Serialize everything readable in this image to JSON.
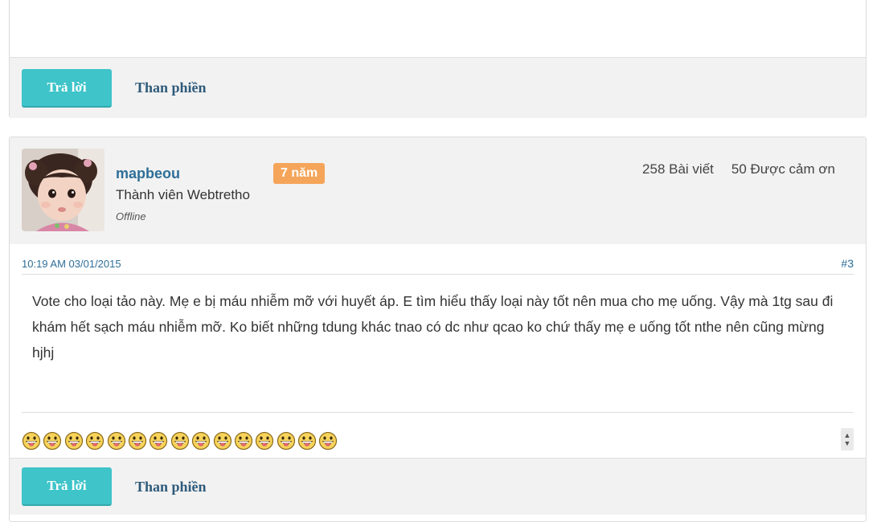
{
  "previous_post": {
    "reply_label": "Trả lời",
    "complain_label": "Than phiền"
  },
  "post": {
    "username": "mapbeou",
    "years_badge": "7 năm",
    "member_title": "Thành viên Webtretho",
    "status": "Offline",
    "stats": {
      "posts": "258 Bài viết",
      "thanks": "50 Được cảm ơn"
    },
    "timestamp": "10:19 AM 03/01/2015",
    "post_number": "#3",
    "content": "Vote cho loại tảo này. Mẹ e bị máu nhiễm mỡ với huyết áp. E tìm hiểu thấy loại này tốt nên mua cho mẹ uống. Vậy mà 1tg sau đi khám hết sạch máu nhiễm mỡ. Ko biết những tdung khác tnao có dc như qcao ko chứ thấy mẹ e uống tốt nthe nên cũng mừng hjhj",
    "emoji_count": 15,
    "emoji_icon": "tongue-out-emoji-icon",
    "reply_label": "Trả lời",
    "complain_label": "Than phiền"
  },
  "colors": {
    "accent": "#3ec4c9",
    "link": "#2e6e98",
    "badge": "#f5a55a",
    "bar_bg": "#f2f2f2"
  }
}
